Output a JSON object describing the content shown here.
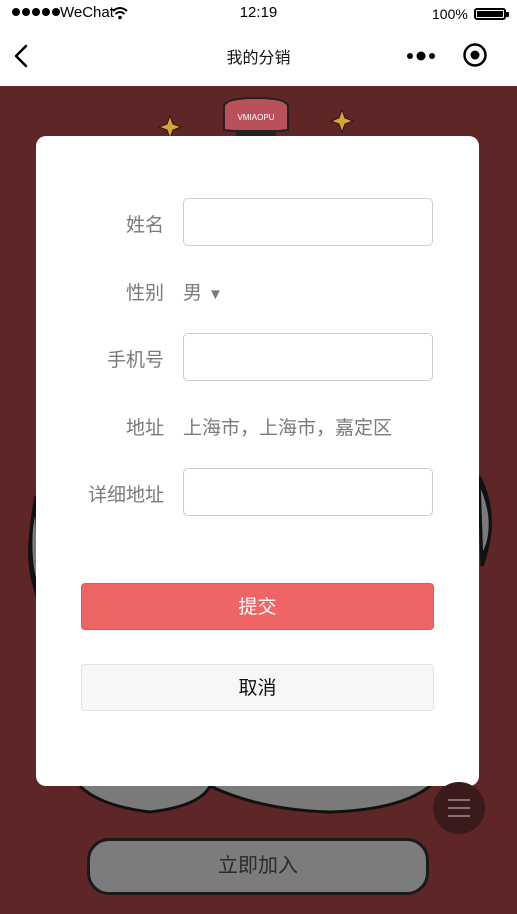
{
  "status_bar": {
    "carrier": "WeChat",
    "time": "12:19",
    "battery": "100%"
  },
  "nav": {
    "title": "我的分销"
  },
  "background": {
    "logo_text": "VMIAOPU"
  },
  "form": {
    "name": {
      "label": "姓名",
      "value": ""
    },
    "gender": {
      "label": "性别",
      "value": "男",
      "arrow": "▼"
    },
    "phone": {
      "label": "手机号",
      "value": ""
    },
    "address": {
      "label": "地址",
      "value": "上海市，上海市，嘉定区"
    },
    "detail_address": {
      "label": "详细地址",
      "value": ""
    },
    "submit_label": "提交",
    "cancel_label": "取消"
  },
  "join_button_label": "立即加入",
  "colors": {
    "background": "#5e2626",
    "submit": "#ef6464",
    "cancel": "#f7f7f7"
  }
}
